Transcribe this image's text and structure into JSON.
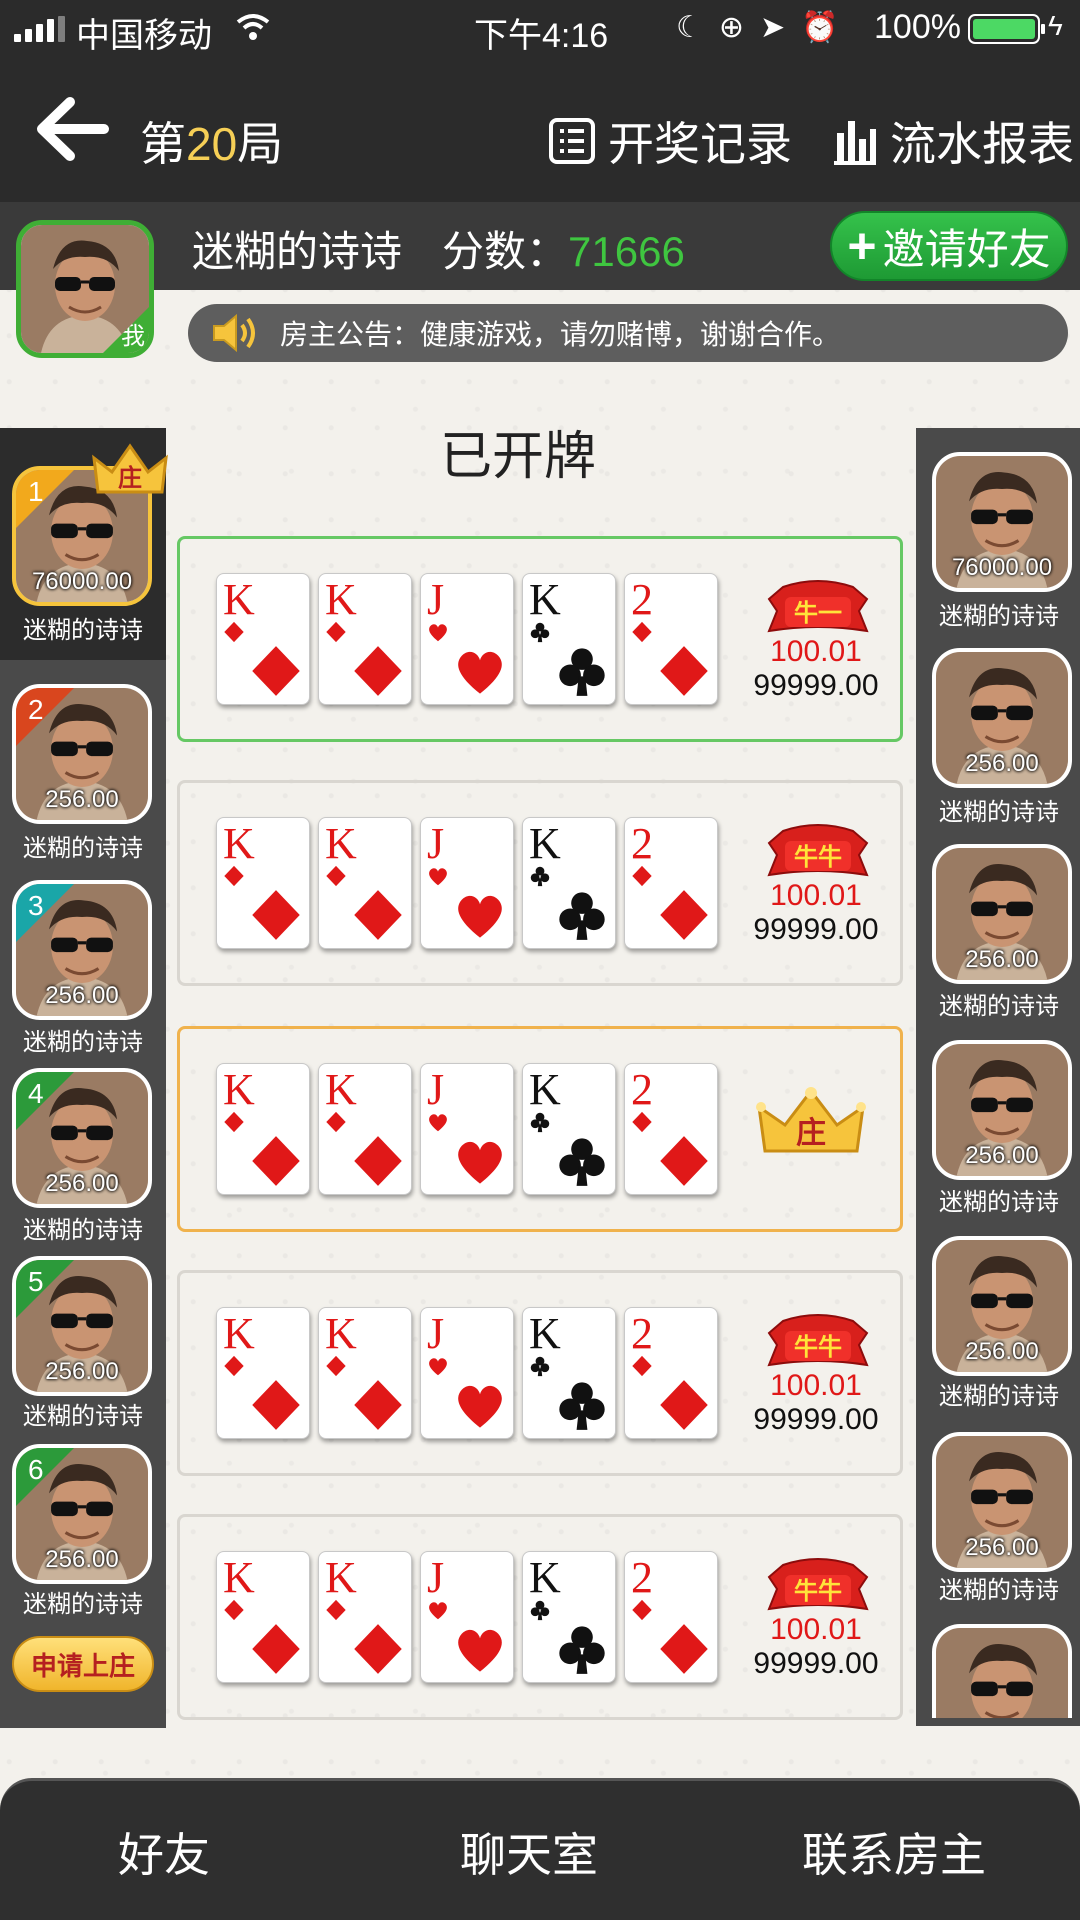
{
  "status_bar": {
    "carrier": "中国移动",
    "time": "下午4:16",
    "battery": "100%"
  },
  "header": {
    "round_prefix": "第",
    "round_number": "20",
    "round_suffix": "局",
    "history_label": "开奖记录",
    "report_label": "流水报表"
  },
  "user": {
    "name": "迷糊的诗诗",
    "score_label": "分数：",
    "score_value": "71666",
    "me_badge": "我",
    "invite_label": "邀请好友"
  },
  "notice": {
    "text": "房主公告：健康游戏，请勿赌博，谢谢合作。"
  },
  "opened_title": "已开牌",
  "banker_crown_text": "庄",
  "left_seats": [
    {
      "num": "1",
      "amount": "76000.00",
      "name": "迷糊的诗诗",
      "color": "#f2a91c"
    },
    {
      "num": "2",
      "amount": "256.00",
      "name": "迷糊的诗诗",
      "color": "#d9461e"
    },
    {
      "num": "3",
      "amount": "256.00",
      "name": "迷糊的诗诗",
      "color": "#1aa6a8"
    },
    {
      "num": "4",
      "amount": "256.00",
      "name": "迷糊的诗诗",
      "color": "#2c9a3a"
    },
    {
      "num": "5",
      "amount": "256.00",
      "name": "迷糊的诗诗",
      "color": "#2c9a3a"
    },
    {
      "num": "6",
      "amount": "256.00",
      "name": "迷糊的诗诗",
      "color": "#2c9a3a"
    }
  ],
  "right_seats": [
    {
      "amount": "76000.00",
      "name": "迷糊的诗诗"
    },
    {
      "amount": "256.00",
      "name": "迷糊的诗诗"
    },
    {
      "amount": "256.00",
      "name": "迷糊的诗诗"
    },
    {
      "amount": "256.00",
      "name": "迷糊的诗诗"
    },
    {
      "amount": "256.00",
      "name": "迷糊的诗诗"
    },
    {
      "amount": "256.00",
      "name": "迷糊的诗诗"
    },
    {
      "amount": "",
      "name": ""
    }
  ],
  "apply_banker_label": "申请上庄",
  "cards": [
    {
      "rank": "K",
      "suit": "diamond"
    },
    {
      "rank": "K",
      "suit": "diamond"
    },
    {
      "rank": "J",
      "suit": "heart"
    },
    {
      "rank": "K",
      "suit": "club"
    },
    {
      "rank": "2",
      "suit": "diamond"
    }
  ],
  "hands": [
    {
      "state": "win",
      "badge": "牛一",
      "rate": "100.01",
      "total": "99999.00"
    },
    {
      "state": "normal",
      "badge": "牛牛",
      "rate": "100.01",
      "total": "99999.00"
    },
    {
      "state": "banker",
      "badge": "",
      "rate": "",
      "total": ""
    },
    {
      "state": "normal",
      "badge": "牛牛",
      "rate": "100.01",
      "total": "99999.00"
    },
    {
      "state": "normal",
      "badge": "牛牛",
      "rate": "100.01",
      "total": "99999.00"
    }
  ],
  "bottom_nav": {
    "friends": "好友",
    "chat": "聊天室",
    "contact": "联系房主"
  },
  "colors": {
    "bar": "#2b2b2b",
    "accent_green": "#3fc640",
    "round_number": "#f6cf56",
    "red": "#e01818"
  }
}
